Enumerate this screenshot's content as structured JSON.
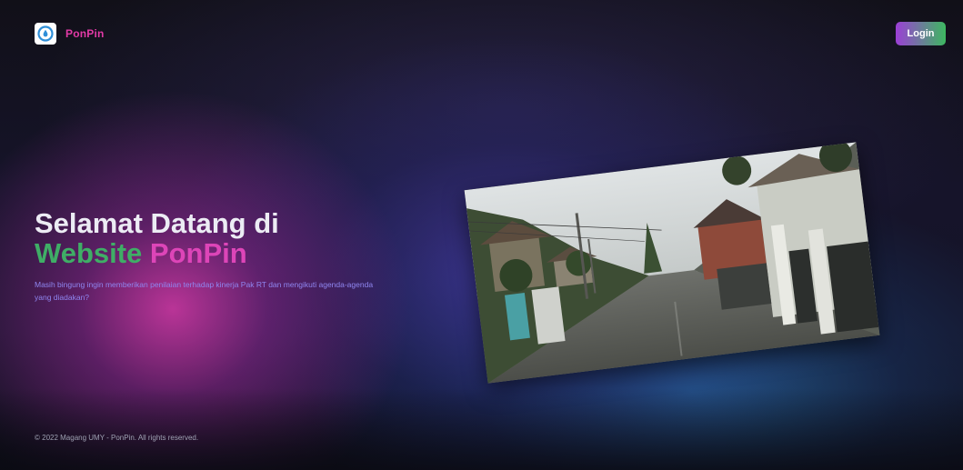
{
  "navbar": {
    "brand_name": "PonPin",
    "logo_icon": "ponpin-logo-icon",
    "login_label": "Login"
  },
  "hero": {
    "headline_line1": "Selamat Datang di",
    "headline_word_website": "Website",
    "headline_word_ponpin": "PonPin",
    "subtitle": "Masih bingung ingin memberikan penilaian terhadap kinerja Pak RT dan mengikuti agenda-agenda yang diadakan?",
    "image_subject": "residential-street-photo"
  },
  "footer": {
    "copyright": "© 2022 Magang UMY - PonPin. All rights reserved."
  },
  "colors": {
    "brand_pink": "#e13aa6",
    "brand_green": "#3fae66",
    "subtitle_purple": "#8f86f0",
    "login_gradient_start": "#9c3fd6",
    "login_gradient_end": "#3db860"
  }
}
